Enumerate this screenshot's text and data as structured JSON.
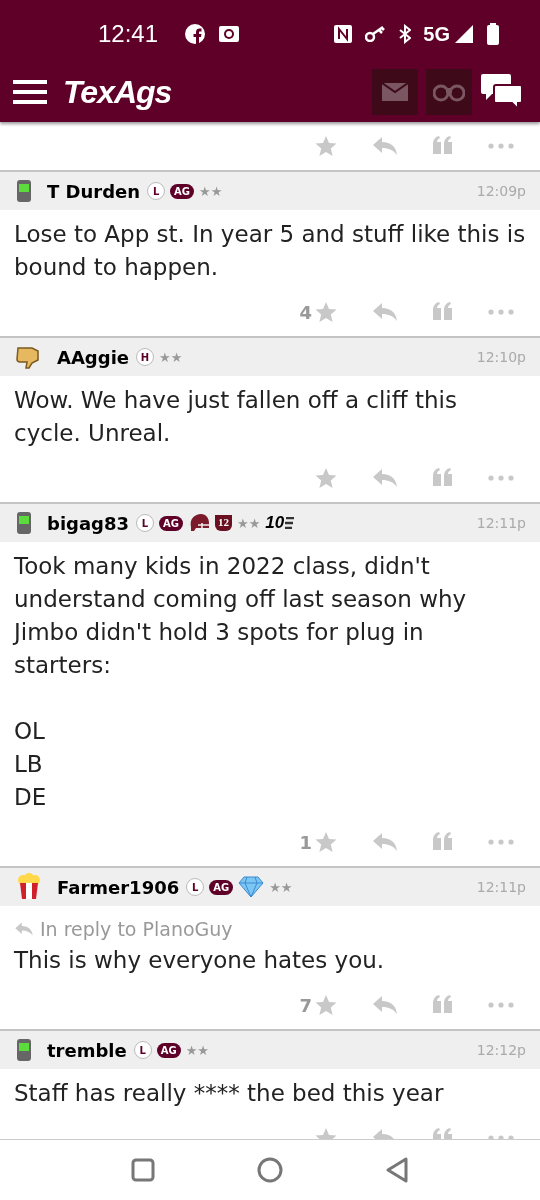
{
  "status_bar": {
    "time": "12:41",
    "network": "5G"
  },
  "app_bar": {
    "logo": "TexAgs"
  },
  "posts": [
    {
      "avatar": {
        "kind": "phone"
      },
      "user": "T Durden",
      "badges": [
        {
          "kind": "circle",
          "text": "L"
        },
        {
          "kind": "pill",
          "text": "AG"
        },
        {
          "kind": "rank",
          "text": "★★"
        }
      ],
      "time": "12:09p",
      "paragraphs": [
        [
          "Lose to App st. In year 5 and stuff like this is bound to happen."
        ]
      ],
      "likes": "4"
    },
    {
      "avatar": {
        "kind": "thumb"
      },
      "user": "AAggie",
      "badges": [
        {
          "kind": "circle",
          "text": "H"
        },
        {
          "kind": "rank",
          "text": "★★"
        }
      ],
      "time": "12:10p",
      "paragraphs": [
        [
          "Wow. We have just fallen off a cliff this cycle. Unreal."
        ]
      ]
    },
    {
      "avatar": {
        "kind": "phone"
      },
      "user": "bigag83",
      "badges": [
        {
          "kind": "circle",
          "text": "L"
        },
        {
          "kind": "pill",
          "text": "AG"
        },
        {
          "kind": "helmet"
        },
        {
          "kind": "shield",
          "text": "12"
        },
        {
          "kind": "rank",
          "text": "★★"
        },
        {
          "kind": "ten",
          "text": "10"
        }
      ],
      "time": "12:11p",
      "paragraphs": [
        [
          "Took many kids in 2022 class, didn't understand coming off last season why Jimbo didn't hold 3 spots for plug in starters:"
        ],
        [
          "OL",
          "LB",
          "DE"
        ]
      ],
      "likes": "1"
    },
    {
      "avatar": {
        "kind": "popcorn"
      },
      "user": "Farmer1906",
      "badges": [
        {
          "kind": "circle",
          "text": "L"
        },
        {
          "kind": "pill",
          "text": "AG"
        },
        {
          "kind": "diamond"
        },
        {
          "kind": "rank",
          "text": "★★"
        }
      ],
      "time": "12:11p",
      "reply_to": "In reply to PlanoGuy",
      "paragraphs": [
        [
          "This is why everyone hates you."
        ]
      ],
      "likes": "7"
    },
    {
      "avatar": {
        "kind": "phone"
      },
      "user": "tremble",
      "badges": [
        {
          "kind": "circle",
          "text": "L"
        },
        {
          "kind": "pill",
          "text": "AG"
        },
        {
          "kind": "rank",
          "text": "★★"
        }
      ],
      "time": "12:12p",
      "paragraphs": [
        [
          "Staff has really **** the bed this year"
        ]
      ]
    }
  ]
}
